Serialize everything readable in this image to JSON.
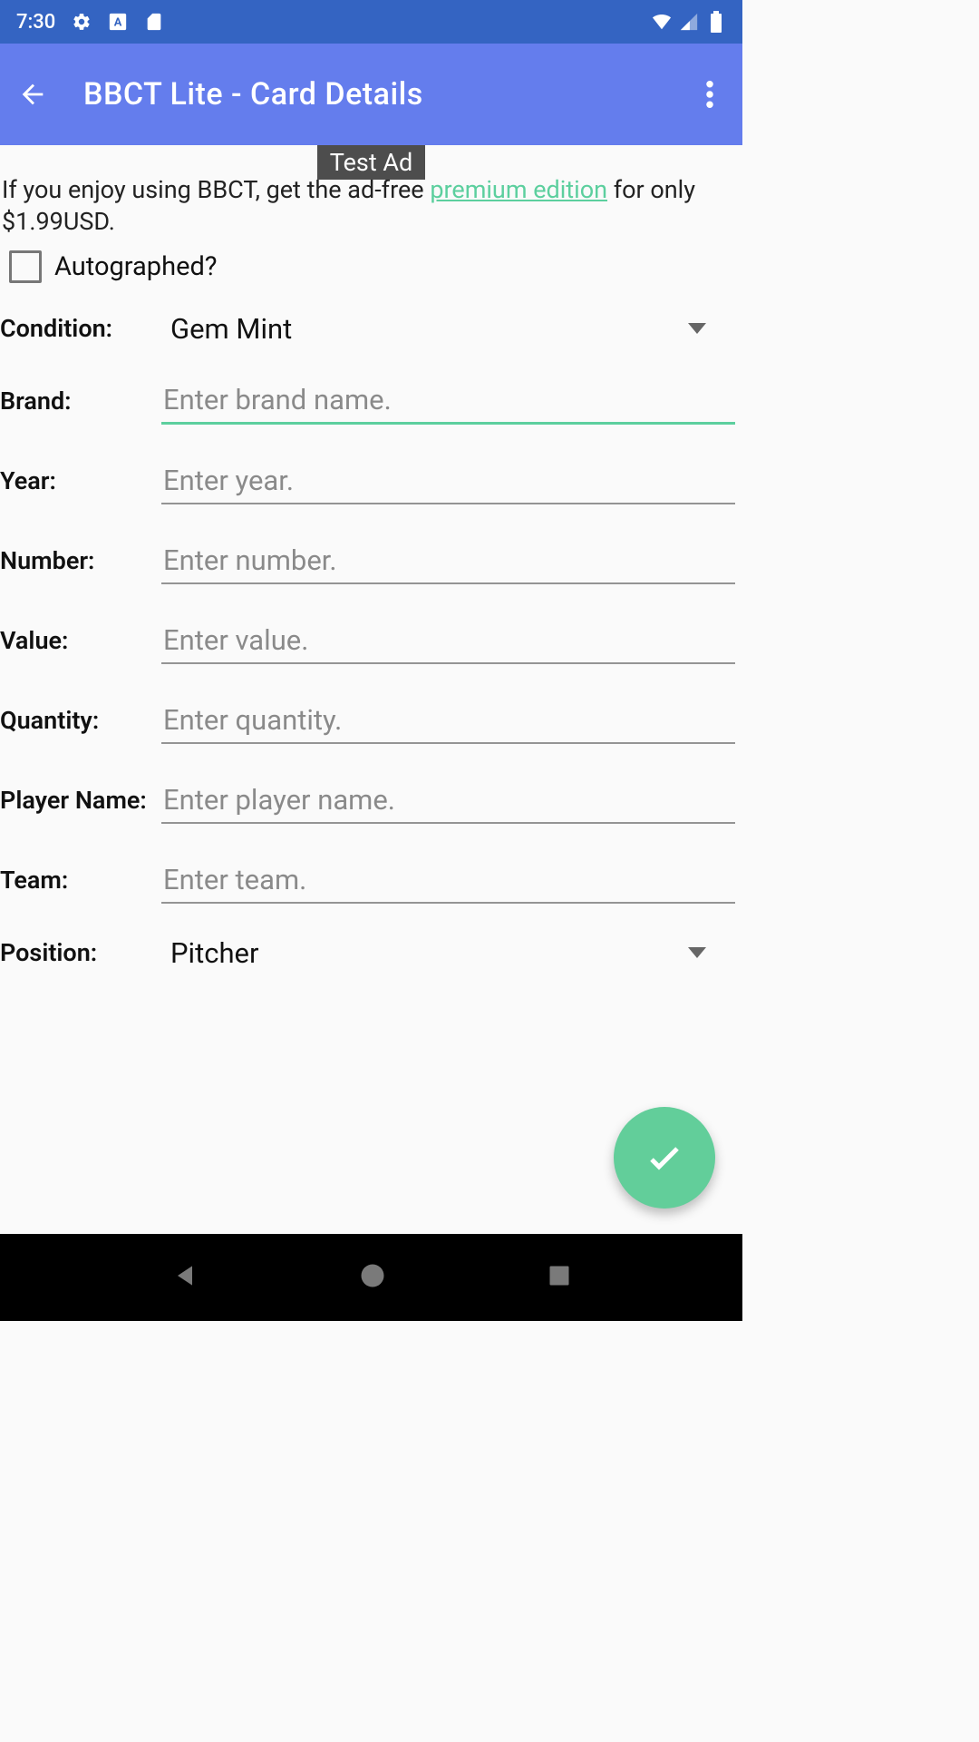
{
  "status": {
    "time": "7:30"
  },
  "appbar": {
    "title": "BBCT Lite - Card Details"
  },
  "ad": {
    "label": "Test Ad",
    "promo_before": "If you enjoy using BBCT, get the ad-free ",
    "promo_link": "premium edition",
    "promo_after": " for only $1.99USD."
  },
  "form": {
    "autographed_label": "Autographed?",
    "condition": {
      "label": "Condition:",
      "value": "Gem Mint"
    },
    "brand": {
      "label": "Brand:",
      "placeholder": "Enter brand name.",
      "value": ""
    },
    "year": {
      "label": "Year:",
      "placeholder": "Enter year.",
      "value": ""
    },
    "number": {
      "label": "Number:",
      "placeholder": "Enter number.",
      "value": ""
    },
    "value": {
      "label": "Value:",
      "placeholder": "Enter value.",
      "value": ""
    },
    "quantity": {
      "label": "Quantity:",
      "placeholder": "Enter quantity.",
      "value": ""
    },
    "player": {
      "label": "Player Name:",
      "placeholder": "Enter player name.",
      "value": ""
    },
    "team": {
      "label": "Team:",
      "placeholder": "Enter team.",
      "value": ""
    },
    "position": {
      "label": "Position:",
      "value": "Pitcher"
    }
  },
  "colors": {
    "status_bar": "#3464c2",
    "app_bar": "#647ded",
    "accent": "#5ccf9e",
    "fab": "#62ce9a"
  }
}
